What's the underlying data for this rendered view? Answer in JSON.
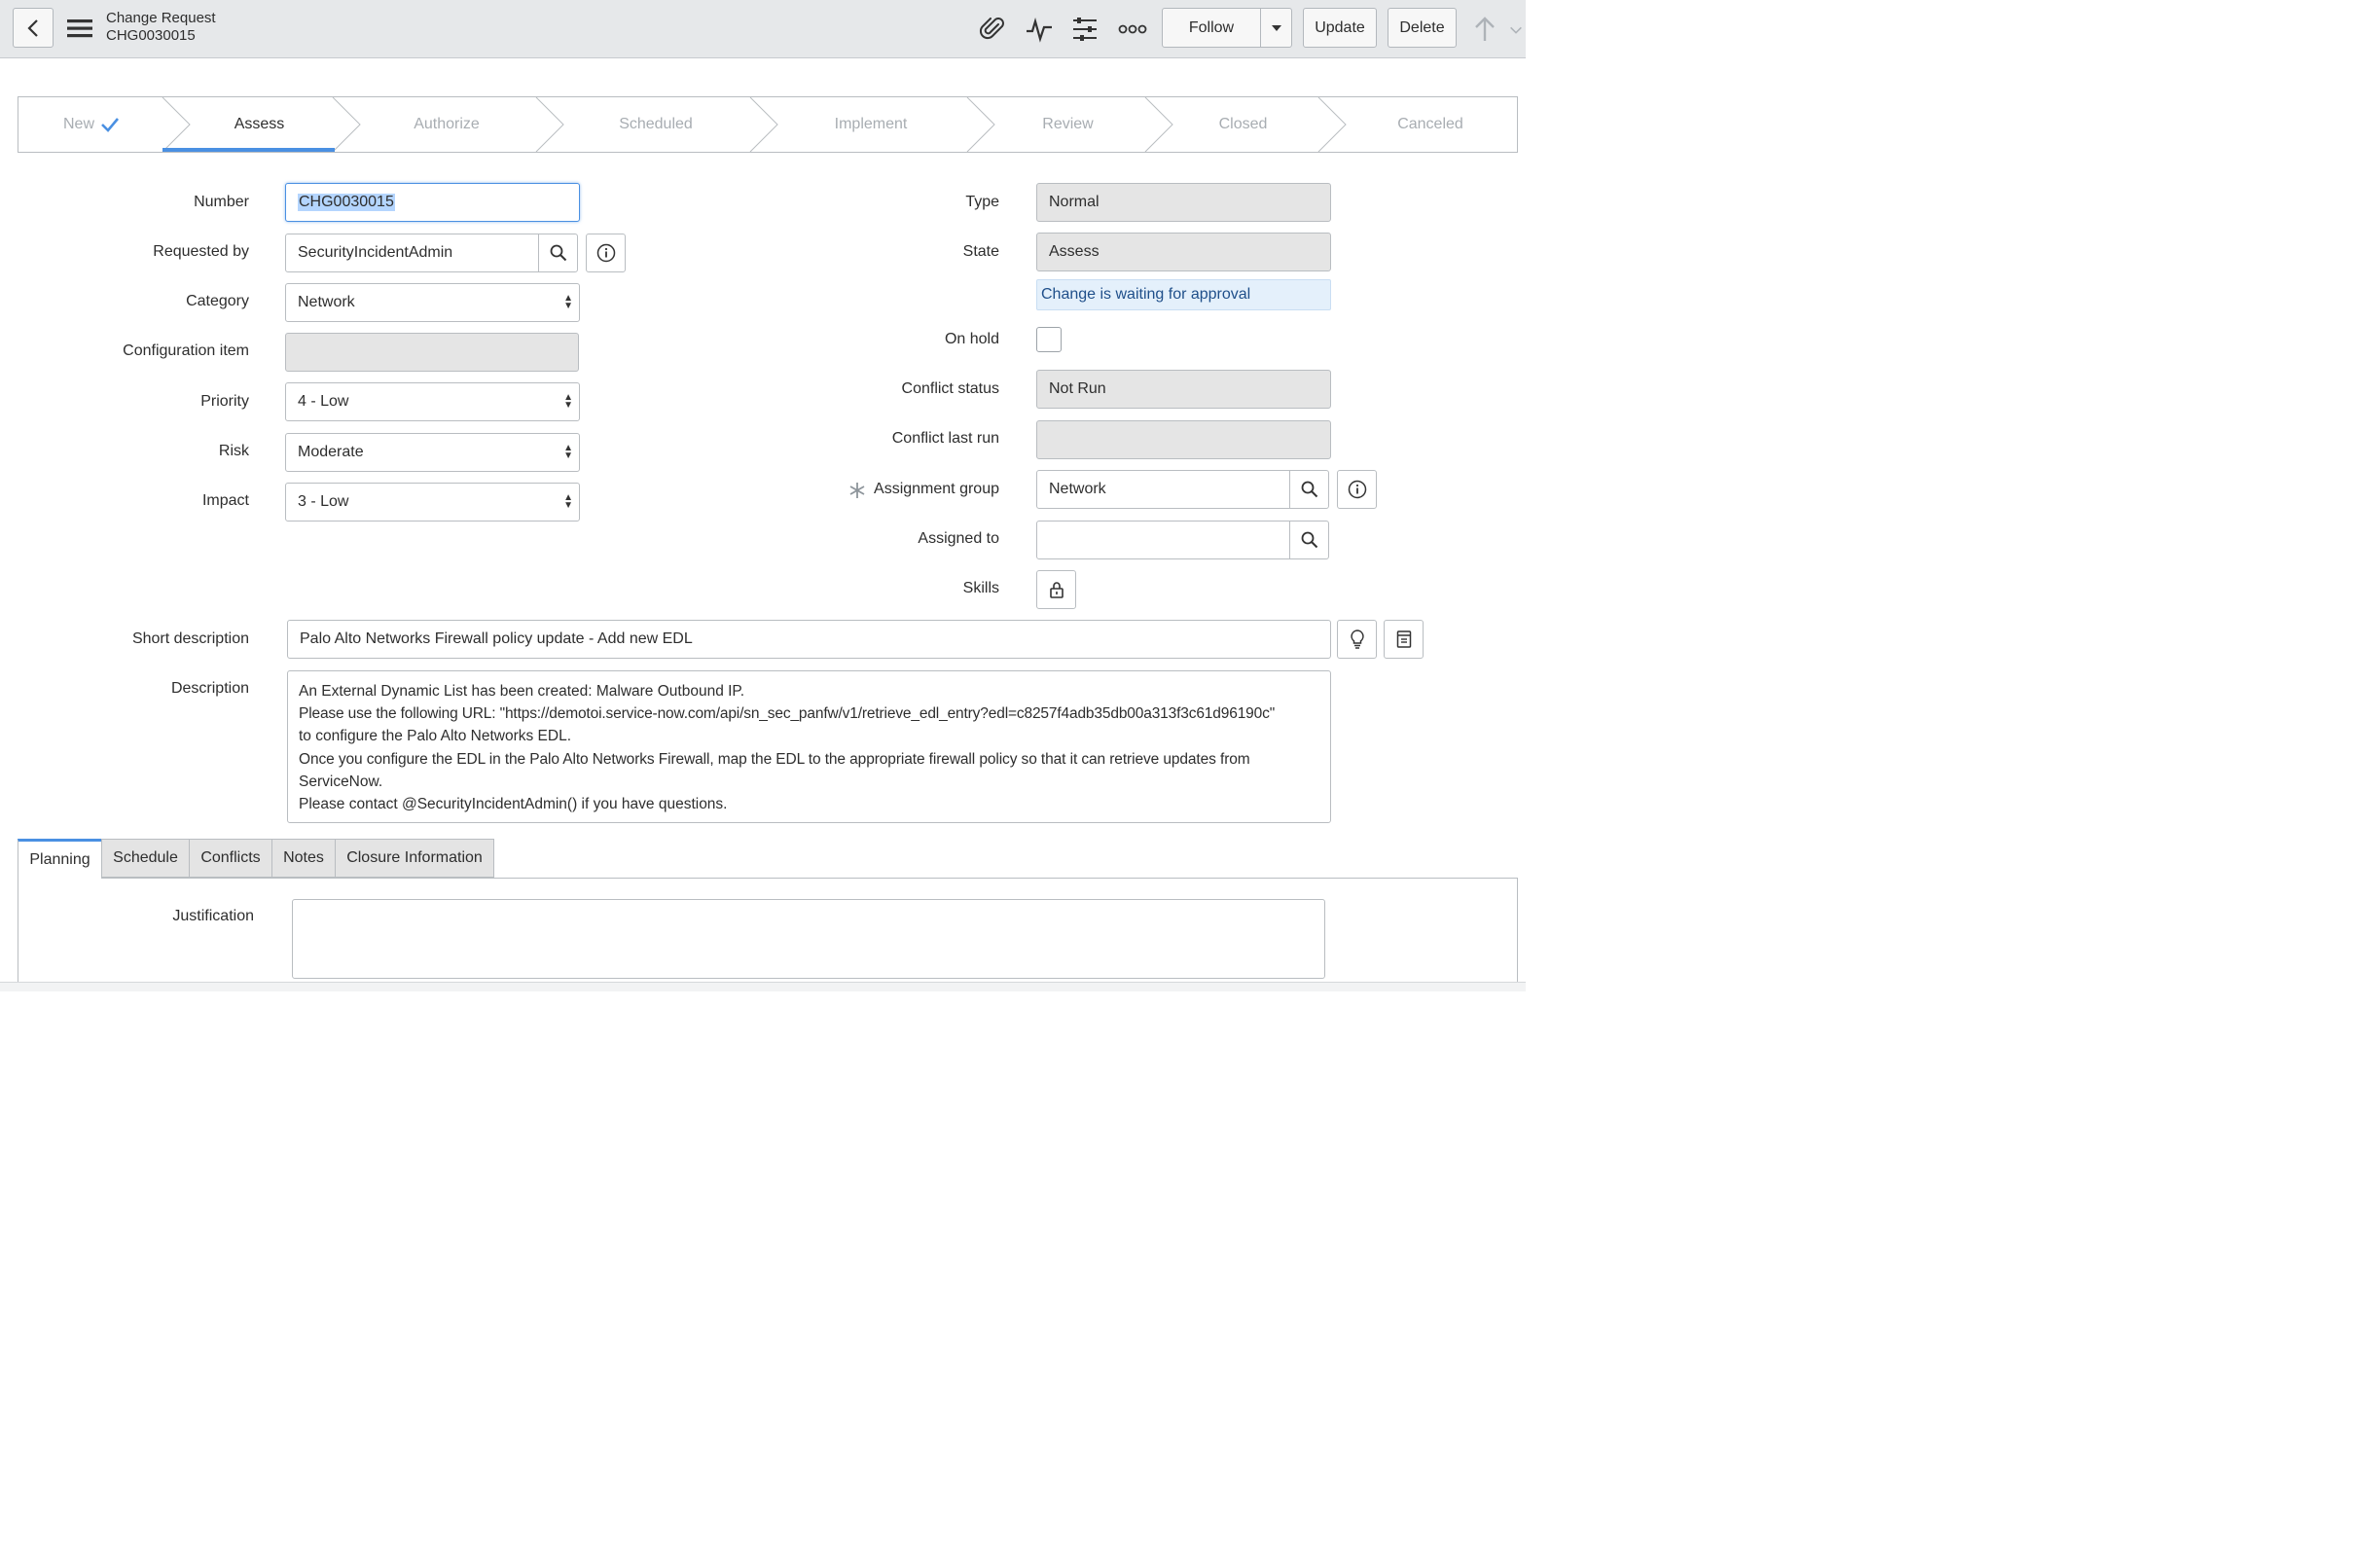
{
  "header": {
    "title": "Change Request",
    "record_number": "CHG0030015",
    "follow_label": "Follow",
    "update_label": "Update",
    "delete_label": "Delete",
    "icons": [
      "back-icon",
      "menu-icon",
      "paperclip-icon",
      "activity-icon",
      "sliders-icon",
      "more-icon",
      "caret-down-icon",
      "up-arrow-icon",
      "down-arrow-icon"
    ]
  },
  "stepper": {
    "steps": [
      "New",
      "Assess",
      "Authorize",
      "Scheduled",
      "Implement",
      "Review",
      "Closed",
      "Canceled"
    ],
    "current": "Assess",
    "completed": [
      "New"
    ]
  },
  "form": {
    "number_label": "Number",
    "number_value": "CHG0030015",
    "requested_by_label": "Requested by",
    "requested_by_value": "SecurityIncidentAdmin",
    "category_label": "Category",
    "category_value": "Network",
    "configuration_item_label": "Configuration item",
    "configuration_item_value": "",
    "priority_label": "Priority",
    "priority_value": "4 - Low",
    "risk_label": "Risk",
    "risk_value": "Moderate",
    "impact_label": "Impact",
    "impact_value": "3 - Low",
    "type_label": "Type",
    "type_value": "Normal",
    "state_label": "State",
    "state_value": "Assess",
    "state_message": "Change is waiting for approval",
    "on_hold_label": "On hold",
    "on_hold_checked": false,
    "conflict_status_label": "Conflict status",
    "conflict_status_value": "Not Run",
    "conflict_last_run_label": "Conflict last run",
    "conflict_last_run_value": "",
    "assignment_group_label": "Assignment group",
    "assignment_group_value": "Network",
    "assigned_to_label": "Assigned to",
    "assigned_to_value": "",
    "skills_label": "Skills",
    "short_description_label": "Short description",
    "short_description_value": "Palo Alto Networks Firewall policy update - Add new EDL",
    "description_label": "Description",
    "description_lines": [
      "An External Dynamic List has been created: Malware Outbound IP.",
      "Please use the following URL: \"https://demotoi.service-now.com/api/sn_sec_panfw/v1/retrieve_edl_entry?edl=c8257f4adb35db00a313f3c61d96190c\"",
      "to configure the Palo Alto Networks EDL.",
      "Once you configure the EDL in the Palo Alto Networks Firewall, map the EDL to the appropriate firewall policy so that it can retrieve updates from",
      "ServiceNow.",
      "Please contact @SecurityIncidentAdmin() if you have questions."
    ]
  },
  "tabs": {
    "items": [
      "Planning",
      "Schedule",
      "Conflicts",
      "Notes",
      "Closure Information"
    ],
    "active": "Planning"
  },
  "planning": {
    "justification_label": "Justification",
    "justification_value": ""
  },
  "colors": {
    "accent": "#4a90e2",
    "header_bg": "#e6e8ea",
    "readonly_bg": "#e5e5e5",
    "message_bg": "#e4f0fb",
    "message_text": "#1f4f8a"
  }
}
